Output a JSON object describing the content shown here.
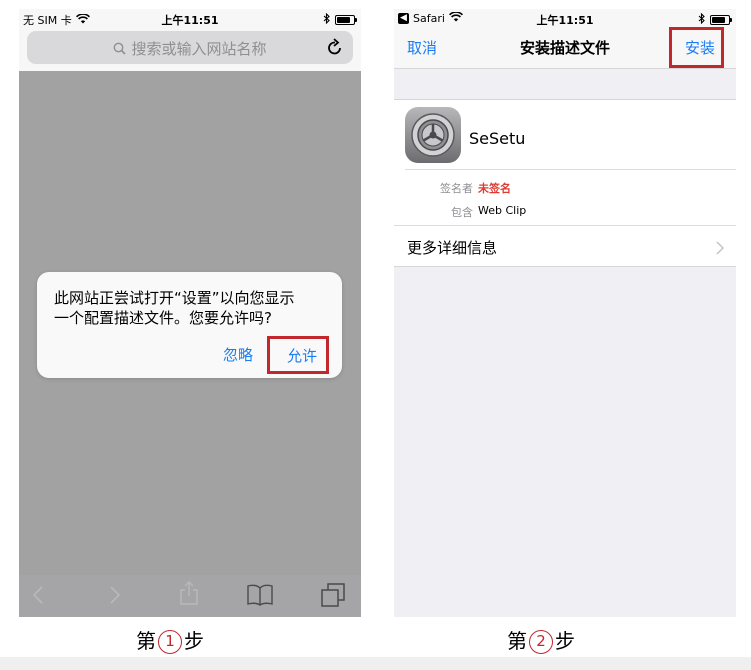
{
  "step1": {
    "status_bar": {
      "carrier": "无 SIM 卡",
      "time": "上午11:51"
    },
    "url_bar": {
      "placeholder": "搜索或输入网站名称"
    },
    "alert": {
      "message_line1": "此网站正尝试打开“设置”以向您显示",
      "message_line2": "一个配置描述文件。您要允许吗?",
      "ignore_label": "忽略",
      "allow_label": "允许"
    },
    "toolbar": {
      "icons": [
        "back-icon",
        "forward-icon",
        "share-icon",
        "bookmarks-icon",
        "tabs-icon"
      ]
    },
    "caption": {
      "prefix": "第",
      "number": "1",
      "suffix": "步"
    }
  },
  "step2": {
    "status_bar": {
      "back_app": "Safari",
      "time": "上午11:51"
    },
    "nav": {
      "cancel_label": "取消",
      "title": "安装描述文件",
      "install_label": "安装"
    },
    "profile": {
      "name": "SeSetu",
      "icon": "settings-gear-icon"
    },
    "meta": [
      {
        "key": "签名者",
        "value": "未签名"
      },
      {
        "key": "包含",
        "value": "Web Clip"
      }
    ],
    "more_details_label": "更多详细信息",
    "caption": {
      "prefix": "第",
      "number": "2",
      "suffix": "步"
    }
  },
  "colors": {
    "ios_blue": "#1a7cf4",
    "highlight_red": "#c1272d",
    "unsigned_red": "#e03b33",
    "dimmed_background": "#a2a2a2",
    "grouped_background": "#efeff4"
  }
}
